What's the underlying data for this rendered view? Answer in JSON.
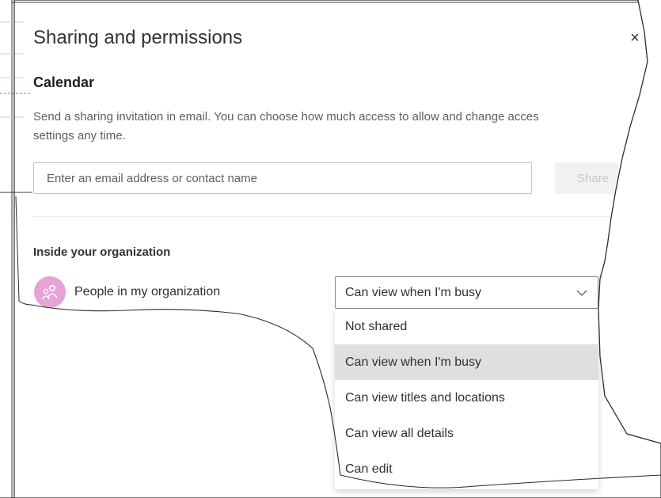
{
  "dialog": {
    "title": "Sharing and permissions",
    "close_symbol": "×",
    "section_title": "Calendar",
    "description_line1": "Send a sharing invitation in email. You can choose how much access to allow and change acces",
    "description_line2": "settings any time.",
    "email_placeholder": "Enter an email address or contact name",
    "share_label": "Share",
    "org_section_title": "Inside your organization",
    "person_label": "People in my organization",
    "selected_permission": "Can view when I'm busy",
    "permission_options": [
      "Not shared",
      "Can view when I'm busy",
      "Can view titles and locations",
      "Can view all details",
      "Can edit"
    ]
  },
  "colors": {
    "accent_avatar": "#e8a3d6",
    "selected_option_bg": "#e1dfdd"
  },
  "icons": {
    "close": "close-icon",
    "avatar": "people-icon",
    "dropdown": "chevron-down-icon"
  }
}
